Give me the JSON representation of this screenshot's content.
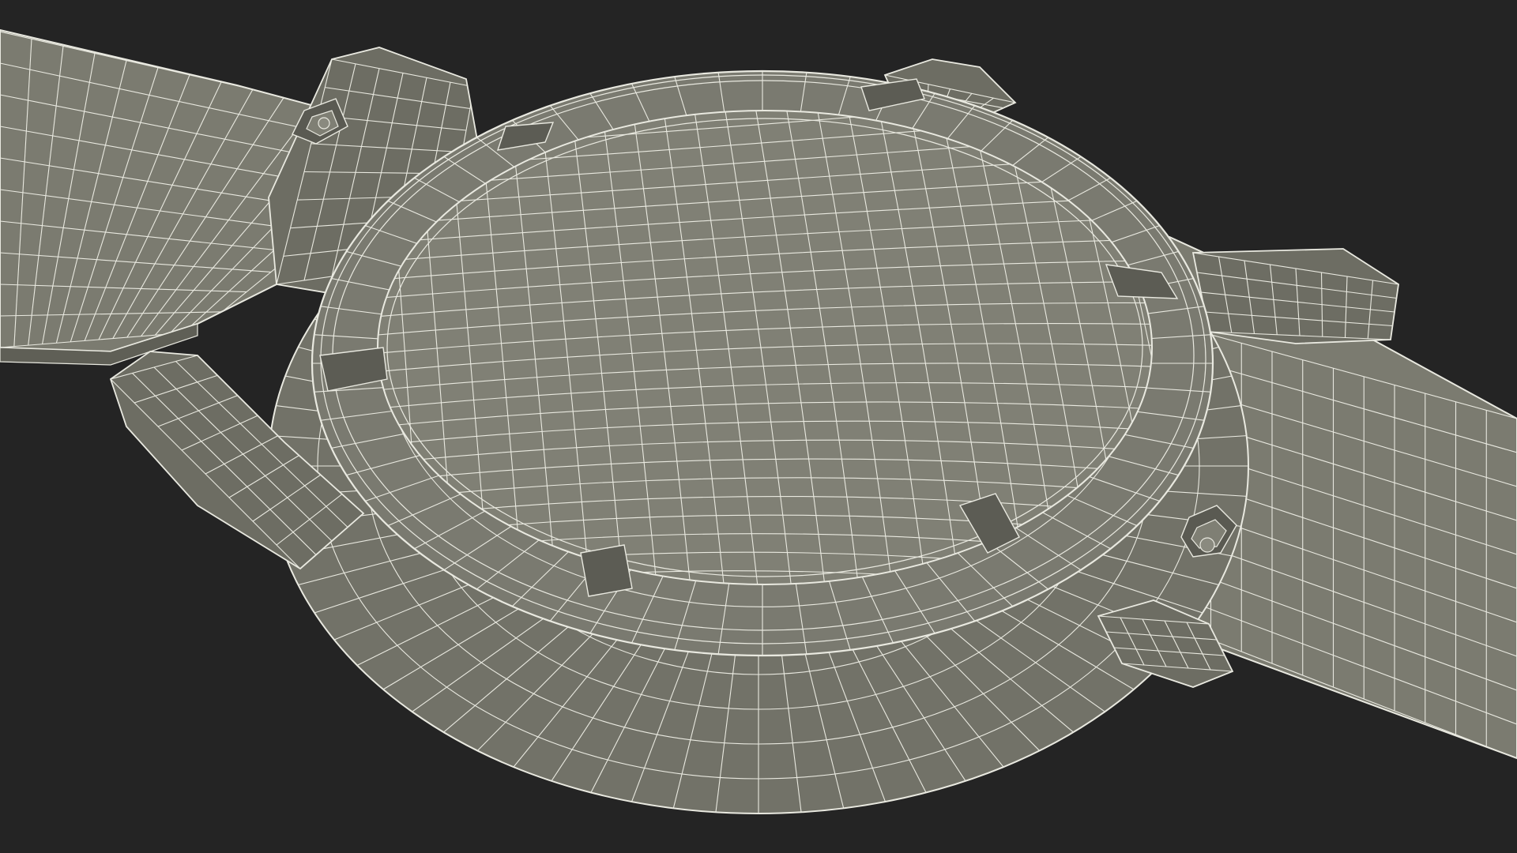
{
  "scene": {
    "subject": "wristwatch-wireframe-render",
    "colors": {
      "background": "#242424",
      "surface": "#7d7d72",
      "surface_dark": "#5f5f56",
      "surface_light": "#8b8b80",
      "wire": "#e9e9e0",
      "shadow": "#1c1c1a"
    }
  }
}
